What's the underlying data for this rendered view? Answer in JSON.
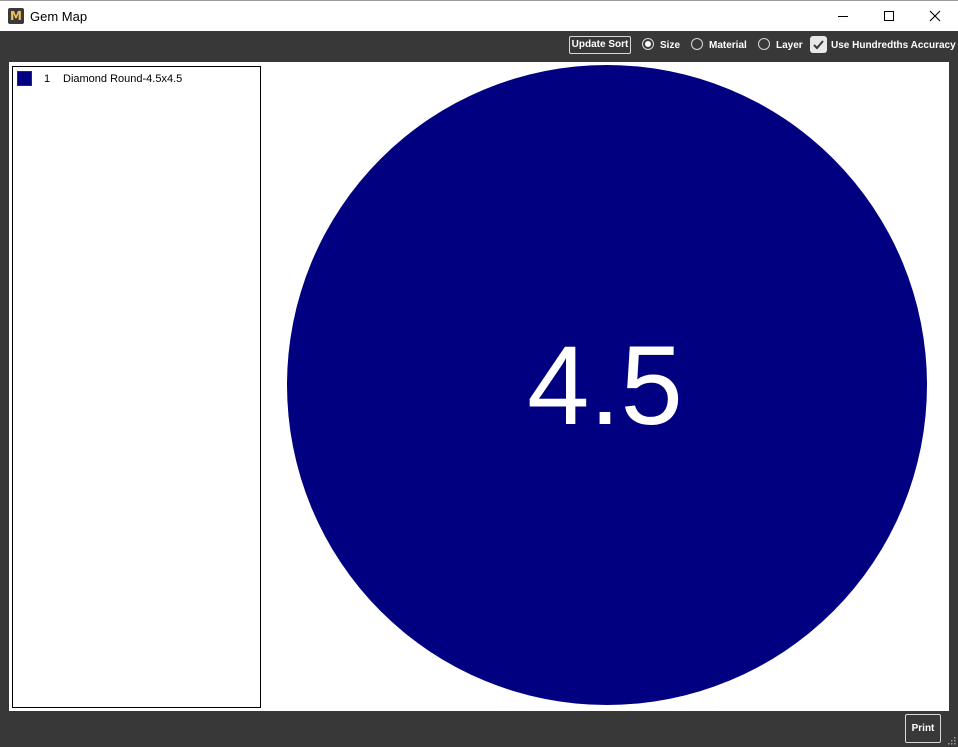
{
  "window": {
    "title": "Gem Map",
    "app_icon_glyph": "M",
    "controls": [
      "minimize-icon",
      "maximize-icon",
      "close-icon"
    ]
  },
  "toolbar": {
    "update_sort_label": "Update Sort",
    "sort_options": [
      {
        "label": "Size",
        "checked": true
      },
      {
        "label": "Material",
        "checked": false
      },
      {
        "label": "Layer",
        "checked": false
      }
    ],
    "hundredths": {
      "label": "Use Hundredths Accuracy",
      "checked": true
    }
  },
  "legend": {
    "items": [
      {
        "index": "1",
        "label": "Diamond Round-4.5x4.5",
        "color": "#000080"
      }
    ]
  },
  "gem_map": {
    "gems": [
      {
        "size_label": "4.5",
        "color": "#000080",
        "text_color": "#ffffff"
      }
    ]
  },
  "footer": {
    "print_label": "Print"
  },
  "colors": {
    "window_bg": "#383838",
    "canvas_bg": "#ffffff",
    "gem_fill": "#000080"
  }
}
